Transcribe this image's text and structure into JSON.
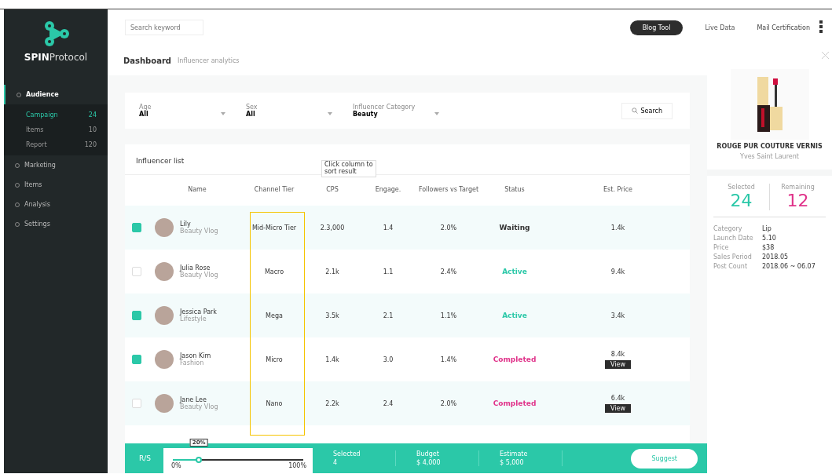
{
  "sidebar": {
    "logo": {
      "bold": "SPIN",
      "light": "Protocol"
    },
    "items": [
      {
        "label": "Audience",
        "selected": true,
        "children": [
          {
            "label": "Campaign",
            "count": "24",
            "selected": true
          },
          {
            "label": "Items",
            "count": "10",
            "selected": false
          },
          {
            "label": "Report",
            "count": "120",
            "selected": false
          }
        ]
      },
      {
        "label": "Marketing",
        "selected": false
      },
      {
        "label": "Items",
        "selected": false
      },
      {
        "label": "Analysis",
        "selected": false
      },
      {
        "label": "Settings",
        "selected": false
      }
    ]
  },
  "topbar": {
    "search": {
      "placeholder": "Search keyword"
    },
    "buttons": [
      {
        "label": "Blog Tool",
        "selected": true
      },
      {
        "label": "Live Data",
        "selected": false
      }
    ],
    "user": "Mail Certification"
  },
  "header": {
    "title": "Dashboard",
    "subtitle": "Influencer analytics"
  },
  "filters": [
    {
      "label": "Age",
      "value": "All"
    },
    {
      "label": "Sex",
      "value": "All"
    },
    {
      "label": "Influencer Category",
      "value": "Beauty"
    }
  ],
  "search_button": "Search",
  "list": {
    "title": "Influencer list",
    "tooltip": [
      "Click column to",
      "sort result"
    ],
    "columns": [
      "Name",
      "Channel Tier",
      "CPS",
      "Engage.",
      "Followers vs Target",
      "Status",
      "Est. Price"
    ],
    "rows": [
      {
        "checked": true,
        "name": "Lily",
        "handle": "Beauty Vlog",
        "tier": "Mid-Micro Tier",
        "cps": "2.3,000",
        "engage": "1.4",
        "followers": "2.0%",
        "status": "Waiting",
        "color": "#333333",
        "price": "1.4k"
      },
      {
        "checked": false,
        "name": "Julia Rose",
        "handle": "Beauty Vlog",
        "tier": "Macro",
        "cps": "2.1k",
        "engage": "1.1",
        "followers": "2.4%",
        "status": "Active",
        "color": "#2bc8a8",
        "price": "9.4k"
      },
      {
        "checked": true,
        "name": "Jessica Park",
        "handle": "Lifestyle",
        "tier": "Mega",
        "cps": "3.5k",
        "engage": "2.1",
        "followers": "1.1%",
        "status": "Active",
        "color": "#2bc8a8",
        "price": "3.4k"
      },
      {
        "checked": true,
        "name": "Jason Kim",
        "handle": "Fashion",
        "tier": "Micro",
        "cps": "1.4k",
        "engage": "3.0",
        "followers": "1.4%",
        "status": "Completed",
        "color": "#e0338a",
        "price": "8.4k",
        "view": "View"
      },
      {
        "checked": false,
        "name": "Jane Lee",
        "handle": "Beauty Vlog",
        "tier": "Nano",
        "cps": "2.2k",
        "engage": "2.4",
        "followers": "2.0%",
        "status": "Completed",
        "color": "#e0338a",
        "price": "6.4k",
        "view": "View"
      }
    ]
  },
  "footer": {
    "label": "R/S",
    "slider": {
      "level": 0.2,
      "reading": "20%",
      "min": "0%",
      "max": "100%"
    },
    "stats": [
      {
        "label": "Selected",
        "value": "4"
      },
      {
        "label": "Budget",
        "value": "$ 4,000"
      },
      {
        "label": "Estimate",
        "value": "$ 5,000"
      }
    ],
    "button": "Suggest"
  },
  "product": {
    "name": "ROUGE PUR COUTURE VERNIS",
    "brand": "Yves Saint Laurent",
    "counts": [
      {
        "label": "Selected",
        "value": "24",
        "color": "#2bc8a8"
      },
      {
        "label": "Remaining",
        "value": "12",
        "color": "#e0338a"
      }
    ],
    "details": [
      {
        "key": "Category",
        "value": "Lip"
      },
      {
        "key": "Launch Date",
        "value": "5.10"
      },
      {
        "key": "Price",
        "value": "$38"
      },
      {
        "key": "Sales Period",
        "value": "2018.05"
      },
      {
        "key": "Post Count",
        "value": "2018.06 ~ 06.07"
      }
    ]
  }
}
